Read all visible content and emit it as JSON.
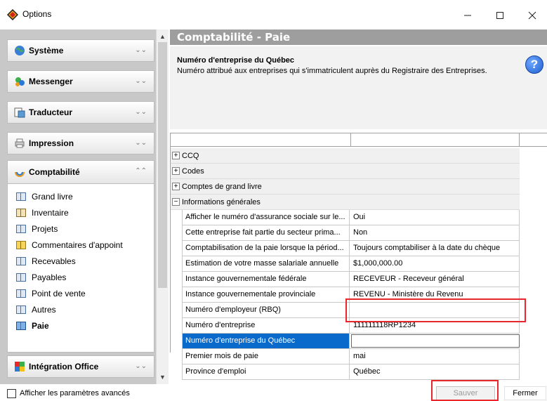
{
  "window": {
    "title": "Options"
  },
  "sidebar": {
    "groups": [
      {
        "label": "Système",
        "icon": "globe-icon"
      },
      {
        "label": "Messenger",
        "icon": "messenger-icon"
      },
      {
        "label": "Traducteur",
        "icon": "translator-icon"
      },
      {
        "label": "Impression",
        "icon": "printer-icon"
      },
      {
        "label": "Comptabilité",
        "icon": "accounting-icon"
      },
      {
        "label": "Intégration Office",
        "icon": "office-icon"
      }
    ],
    "items": [
      {
        "label": "Grand livre"
      },
      {
        "label": "Inventaire"
      },
      {
        "label": "Projets"
      },
      {
        "label": "Commentaires d'appoint"
      },
      {
        "label": "Recevables"
      },
      {
        "label": "Payables"
      },
      {
        "label": "Point de vente"
      },
      {
        "label": "Autres"
      },
      {
        "label": "Paie"
      }
    ]
  },
  "main": {
    "header": "Comptabilité - Paie",
    "info_title": "Numéro d'entreprise du Québec",
    "info_desc": "Numéro attribué aux entreprises qui s'immatriculent auprès du Registraire des Entreprises.",
    "groups": [
      {
        "label": "CCQ",
        "expander": "+"
      },
      {
        "label": "Codes",
        "expander": "+"
      },
      {
        "label": "Comptes de grand livre",
        "expander": "+"
      },
      {
        "label": "Informations générales",
        "expander": "−"
      }
    ],
    "properties": [
      {
        "name": "Afficher le numéro d'assurance sociale sur le...",
        "value": "Oui"
      },
      {
        "name": "Cette entreprise fait partie du secteur prima...",
        "value": "Non"
      },
      {
        "name": "Comptabilisation de la paie lorsque la périod...",
        "value": "Toujours comptabiliser à la date du chèque"
      },
      {
        "name": "Estimation de votre masse salariale annuelle",
        "value": "$1,000,000.00"
      },
      {
        "name": "Instance gouvernementale fédérale",
        "value": "RECEVEUR - Receveur général"
      },
      {
        "name": "Instance gouvernementale provinciale",
        "value": "REVENU - Ministère du Revenu"
      },
      {
        "name": "Numéro d'employeur (RBQ)",
        "value": ""
      },
      {
        "name": "Numéro d'entreprise",
        "value": "111111118RP1234"
      },
      {
        "name": "Numéro d'entreprise du Québec",
        "value": ""
      },
      {
        "name": "Premier mois de paie",
        "value": "mai"
      },
      {
        "name": "Province d'emploi",
        "value": "Québec"
      }
    ]
  },
  "footer": {
    "advanced_label": "Afficher les paramètres avancés",
    "save_label": "Sauver",
    "close_label": "Fermer"
  },
  "colors": {
    "selection": "#0a6acb",
    "highlight": "#e8262b",
    "header_bg": "#9e9e9e"
  }
}
